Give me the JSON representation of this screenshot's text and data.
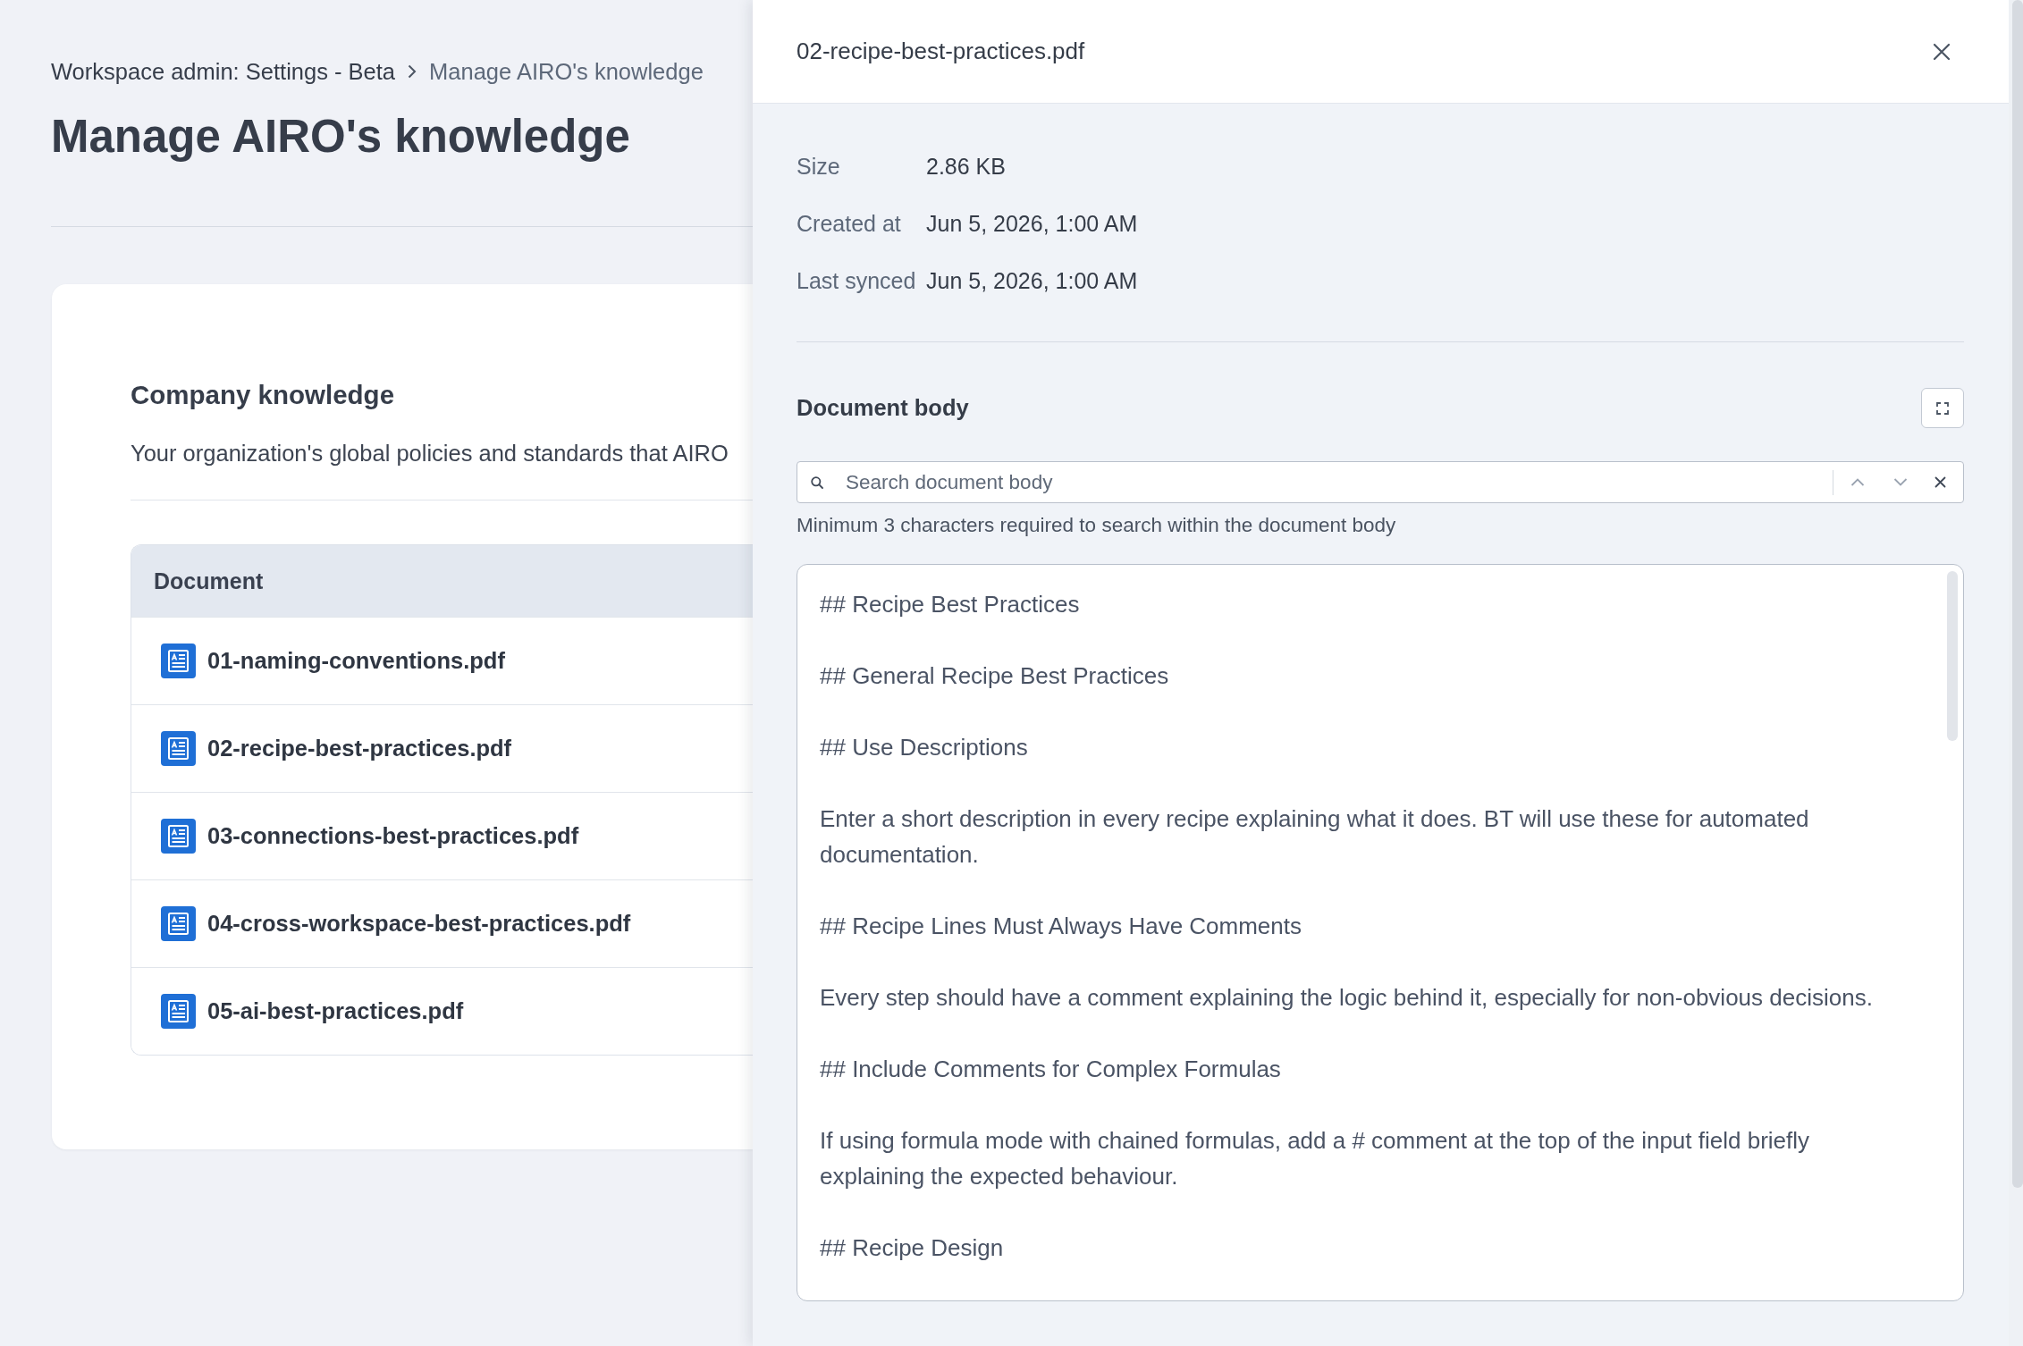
{
  "breadcrumb": [
    {
      "label": "Workspace admin: Settings - Beta",
      "current": false
    },
    {
      "label": "Manage AIRO's knowledge",
      "current": true
    }
  ],
  "page_title": "Manage AIRO's knowledge",
  "section": {
    "title": "Company knowledge",
    "description": "Your organization's global policies and standards that AIRO"
  },
  "table": {
    "columns": [
      "Document"
    ],
    "rows": [
      {
        "name": "01-naming-conventions.pdf"
      },
      {
        "name": "02-recipe-best-practices.pdf"
      },
      {
        "name": "03-connections-best-practices.pdf"
      },
      {
        "name": "04-cross-workspace-best-practices.pdf"
      },
      {
        "name": "05-ai-best-practices.pdf"
      }
    ]
  },
  "panel": {
    "title": "02-recipe-best-practices.pdf",
    "details": [
      {
        "label": "Size",
        "value": "2.86 KB"
      },
      {
        "label": "Created at",
        "value": "Jun 5, 2026, 1:00 AM"
      },
      {
        "label": "Last synced",
        "value": "Jun 5, 2026, 1:00 AM"
      }
    ],
    "document_body": {
      "title": "Document body",
      "search": {
        "placeholder": "Search document body"
      },
      "hint": "Minimum 3 characters required to search within the document body",
      "paragraphs": [
        "## Recipe Best Practices",
        "## General Recipe Best Practices",
        "## Use Descriptions",
        "Enter a short description in every recipe explaining what it does. BT will use these for automated documentation.",
        "## Recipe Lines Must Always Have Comments",
        "Every step should have a comment explaining the logic behind it, especially for non-obvious decisions.",
        "## Include Comments for Complex Formulas",
        "If using formula mode with chained formulas, add a # comment at the top of the input field briefly explaining the expected behaviour.",
        "## Recipe Design"
      ]
    }
  }
}
